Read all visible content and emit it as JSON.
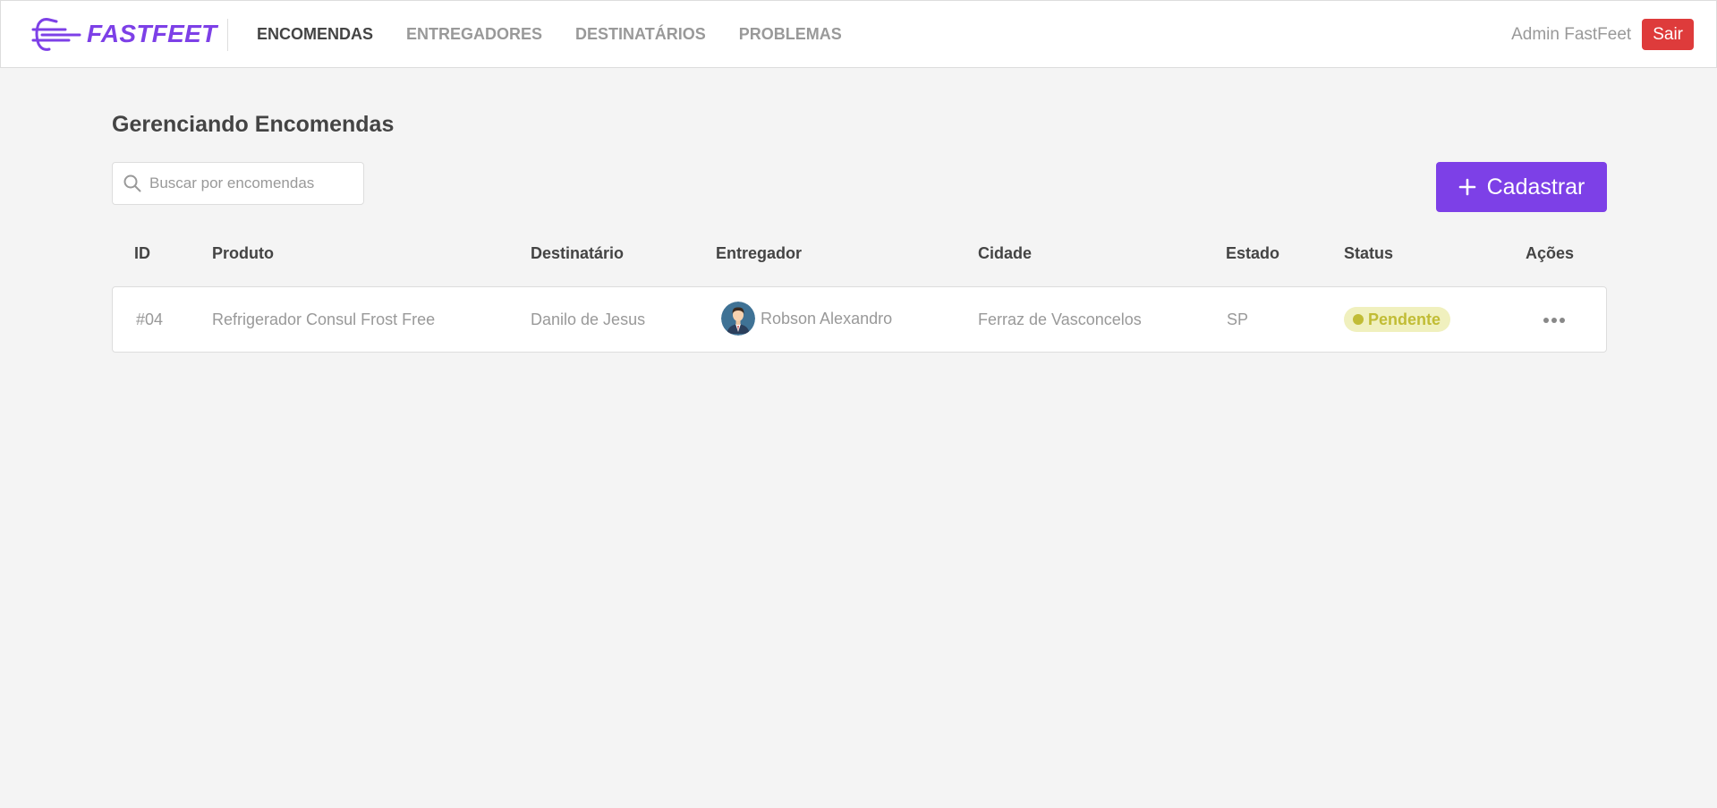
{
  "header": {
    "logo_text": "FASTFEET",
    "nav": [
      {
        "label": "ENCOMENDAS",
        "active": true
      },
      {
        "label": "ENTREGADORES",
        "active": false
      },
      {
        "label": "DESTINATÁRIOS",
        "active": false
      },
      {
        "label": "PROBLEMAS",
        "active": false
      }
    ],
    "user_name": "Admin FastFeet",
    "logout_label": "Sair"
  },
  "main": {
    "title": "Gerenciando Encomendas",
    "search": {
      "placeholder": "Buscar por encomendas",
      "value": "",
      "icon": "search-icon"
    },
    "add_button": {
      "label": "Cadastrar",
      "icon": "plus-icon"
    },
    "table": {
      "columns": [
        "ID",
        "Produto",
        "Destinatário",
        "Entregador",
        "Cidade",
        "Estado",
        "Status",
        "Ações"
      ],
      "rows": [
        {
          "id": "#04",
          "product": "Refrigerador Consul Frost Free",
          "recipient": "Danilo de Jesus",
          "courier": "Robson Alexandro",
          "city": "Ferraz de Vasconcelos",
          "state": "SP",
          "status": "Pendente",
          "status_color": "#c1bc35",
          "status_bg": "#f0f0be"
        }
      ]
    }
  },
  "colors": {
    "accent": "#7d40e7",
    "danger": "#de3b3b",
    "background": "#f4f4f4"
  }
}
